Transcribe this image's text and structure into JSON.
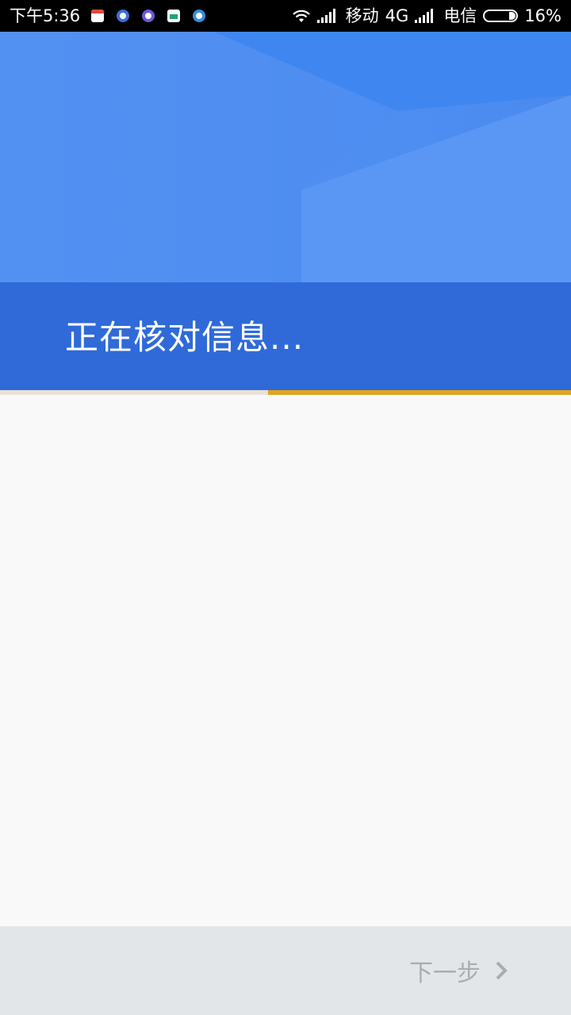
{
  "status_bar": {
    "time": "下午5:36",
    "carrier1": "移动",
    "network": "4G",
    "carrier2": "电信",
    "battery": "16%",
    "notification_icons": [
      "calendar-icon",
      "app-icon",
      "app-icon",
      "clipboard-icon",
      "app-icon"
    ]
  },
  "header": {
    "title": "正在核对信息...",
    "progress": 0.47
  },
  "footer": {
    "next_label": "下一步"
  },
  "colors": {
    "hero": "#4b8cf2",
    "title_band": "#2f6ad8",
    "progress_accent": "#e1a51b",
    "background": "#f9f9f9",
    "footer": "#e3e6e9",
    "disabled_text": "#a9adb2"
  }
}
